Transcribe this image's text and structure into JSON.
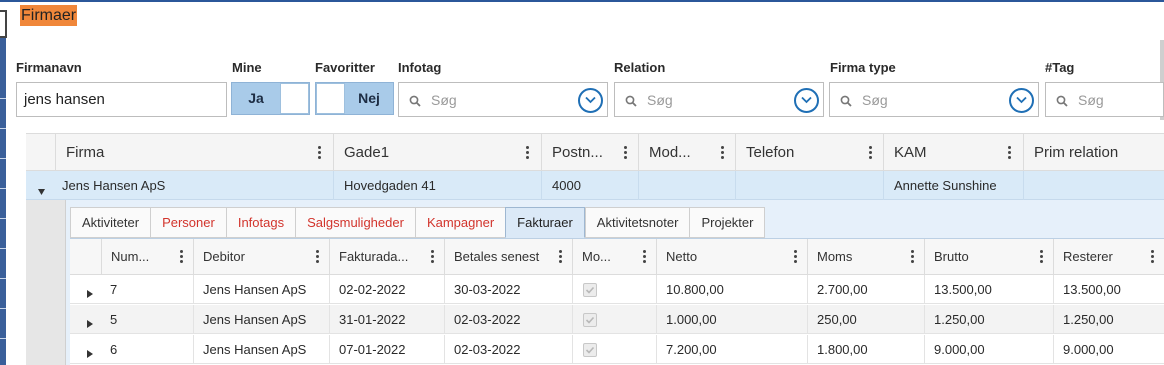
{
  "page": {
    "title": "Firmaer"
  },
  "filters": {
    "firmanavn": {
      "label": "Firmanavn",
      "value": "jens hansen"
    },
    "mine": {
      "label": "Mine",
      "on_label": "Ja"
    },
    "favoritter": {
      "label": "Favoritter",
      "on_label": "Nej"
    },
    "infotag": {
      "label": "Infotag",
      "placeholder": "Søg"
    },
    "relation": {
      "label": "Relation",
      "placeholder": "Søg"
    },
    "firma_type": {
      "label": "Firma type",
      "placeholder": "Søg"
    },
    "tag": {
      "label": "#Tag",
      "placeholder": "Søg"
    }
  },
  "grid": {
    "columns": [
      "Firma",
      "Gade1",
      "Postn...",
      "Mod...",
      "Telefon",
      "KAM",
      "Prim relation"
    ],
    "rows": [
      {
        "firma": "Jens Hansen ApS",
        "gade1": "Hovedgaden 41",
        "postnr": "4000",
        "mod": "",
        "telefon": "",
        "kam": "Annette Sunshine",
        "prim_relation": ""
      }
    ]
  },
  "detail": {
    "tabs": [
      {
        "label": "Aktiviteter",
        "color": "#333333"
      },
      {
        "label": "Personer",
        "color": "#d2342c"
      },
      {
        "label": "Infotags",
        "color": "#d2342c"
      },
      {
        "label": "Salgsmuligheder",
        "color": "#d2342c"
      },
      {
        "label": "Kampagner",
        "color": "#d2342c"
      },
      {
        "label": "Fakturaer",
        "color": "#222222",
        "active": true
      },
      {
        "label": "Aktivitetsnoter",
        "color": "#333333"
      },
      {
        "label": "Projekter",
        "color": "#333333"
      }
    ],
    "invoice_grid": {
      "columns": [
        "Num...",
        "Debitor",
        "Fakturada...",
        "Betales senest",
        "Mo...",
        "Netto",
        "Moms",
        "Brutto",
        "Resterer"
      ],
      "rows": [
        {
          "num": "7",
          "debitor": "Jens Hansen ApS",
          "fakturadato": "02-02-2022",
          "betales_senest": "30-03-2022",
          "mo": true,
          "netto": "10.800,00",
          "moms": "2.700,00",
          "brutto": "13.500,00",
          "resterer": "13.500,00"
        },
        {
          "num": "5",
          "debitor": "Jens Hansen ApS",
          "fakturadato": "31-01-2022",
          "betales_senest": "02-03-2022",
          "mo": true,
          "netto": "1.000,00",
          "moms": "250,00",
          "brutto": "1.250,00",
          "resterer": "1.250,00"
        },
        {
          "num": "6",
          "debitor": "Jens Hansen ApS",
          "fakturadato": "07-01-2022",
          "betales_senest": "02-03-2022",
          "mo": true,
          "netto": "7.200,00",
          "moms": "1.800,00",
          "brutto": "9.000,00",
          "resterer": "9.000,00"
        }
      ]
    }
  },
  "colors": {
    "title_highlight": "#f0873a",
    "accent": "#1f6fb5",
    "toggle_on": "#a9cbe9",
    "selected_row": "#d9eaf8",
    "red_tab": "#d2342c"
  },
  "icons": {
    "search": "magnifier-icon",
    "dropdown": "chevron-down-circle-icon",
    "column_menu": "kebab-icon",
    "expand": "triangle-right-icon",
    "collapse": "triangle-down-icon"
  }
}
